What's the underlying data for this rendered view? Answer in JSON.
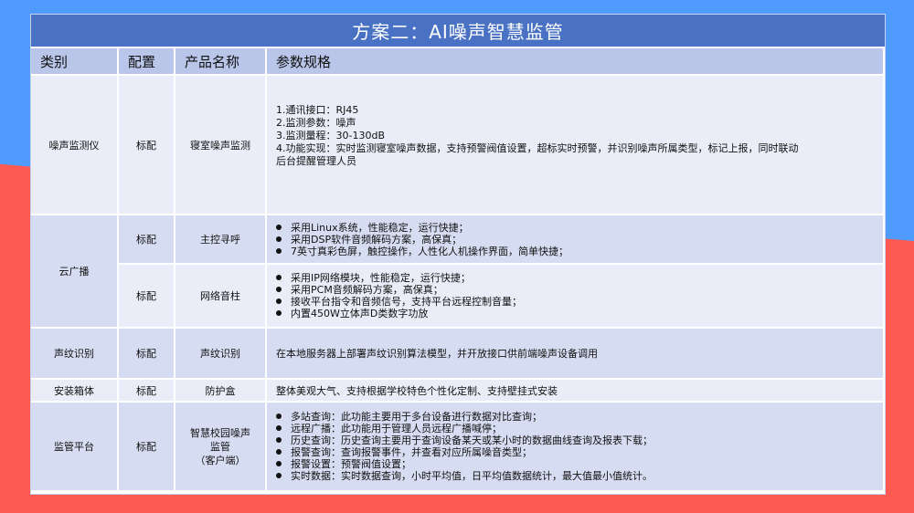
{
  "title": "方案二：AI噪声智慧监管",
  "headers": [
    "类别",
    "配置",
    "产品名称",
    "参数规格"
  ],
  "rows": {
    "noise": {
      "category": "噪声监测仪",
      "config": "标配",
      "product": "寝室噪声监测",
      "spec": [
        "1.通讯接口：RJ45",
        "2.监测参数：噪声",
        "3.监测量程：30-130dB",
        "4.功能实现：实时监测寝室噪声数据，支持预警阀值设置，超标实时预警，并识别噪声所属类型，标记上报，同时联动",
        "后台提醒管理人员"
      ]
    },
    "cloud": {
      "category": "云广播",
      "sub1": {
        "config": "标配",
        "product": "主控寻呼",
        "bullets": [
          "采用Linux系统，性能稳定，运行快捷；",
          "采用DSP软件音频解码方案，高保真；",
          "7英寸真彩色屏，触控操作，人性化人机操作界面，简单快捷；"
        ]
      },
      "sub2": {
        "config": "标配",
        "product": "网络音柱",
        "bullets": [
          "采用IP网络模块，性能稳定，运行快捷；",
          "采用PCM音频解码方案，高保真；",
          "接收平台指令和音频信号，支持平台远程控制音量；",
          "内置450W立体声D类数字功放"
        ]
      }
    },
    "voiceprint": {
      "category": "声纹识别",
      "config": "标配",
      "product": "声纹识别",
      "spec": "在本地服务器上部署声纹识别算法模型，并开放接口供前端噪声设备调用"
    },
    "box": {
      "category": "安装箱体",
      "config": "标配",
      "product": "防护盒",
      "spec": "整体美观大气、支持根据学校特色个性化定制、支持壁挂式安装"
    },
    "platform": {
      "category": "监管平台",
      "config": "标配",
      "product_line1": "智慧校园噪声",
      "product_line2": "监管",
      "product_line3": "（客户端）",
      "bullets": [
        "多站查询：此功能主要用于多台设备进行数据对比查询；",
        "远程广播：此功能用于管理人员远程广播喊停；",
        "历史查询：历史查询主要用于查询设备某天或某小时的数据曲线查询及报表下载；",
        "报警查询：查询报警事件，并查看对应所属噪音类型；",
        "报警设置：预警阀值设置；",
        "实时数据：实时数据查询，小时平均值，日平均值数据统计，最大值最小值统计。"
      ]
    }
  }
}
